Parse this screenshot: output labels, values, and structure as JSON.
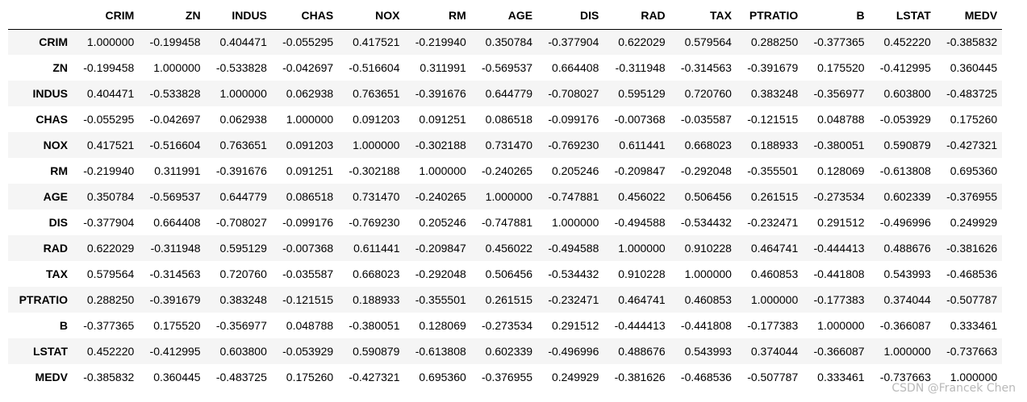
{
  "table": {
    "columns": [
      "CRIM",
      "ZN",
      "INDUS",
      "CHAS",
      "NOX",
      "RM",
      "AGE",
      "DIS",
      "RAD",
      "TAX",
      "PTRATIO",
      "B",
      "LSTAT",
      "MEDV"
    ],
    "rows": [
      {
        "label": "CRIM",
        "values": [
          "1.000000",
          "-0.199458",
          "0.404471",
          "-0.055295",
          "0.417521",
          "-0.219940",
          "0.350784",
          "-0.377904",
          "0.622029",
          "0.579564",
          "0.288250",
          "-0.377365",
          "0.452220",
          "-0.385832"
        ]
      },
      {
        "label": "ZN",
        "values": [
          "-0.199458",
          "1.000000",
          "-0.533828",
          "-0.042697",
          "-0.516604",
          "0.311991",
          "-0.569537",
          "0.664408",
          "-0.311948",
          "-0.314563",
          "-0.391679",
          "0.175520",
          "-0.412995",
          "0.360445"
        ]
      },
      {
        "label": "INDUS",
        "values": [
          "0.404471",
          "-0.533828",
          "1.000000",
          "0.062938",
          "0.763651",
          "-0.391676",
          "0.644779",
          "-0.708027",
          "0.595129",
          "0.720760",
          "0.383248",
          "-0.356977",
          "0.603800",
          "-0.483725"
        ]
      },
      {
        "label": "CHAS",
        "values": [
          "-0.055295",
          "-0.042697",
          "0.062938",
          "1.000000",
          "0.091203",
          "0.091251",
          "0.086518",
          "-0.099176",
          "-0.007368",
          "-0.035587",
          "-0.121515",
          "0.048788",
          "-0.053929",
          "0.175260"
        ]
      },
      {
        "label": "NOX",
        "values": [
          "0.417521",
          "-0.516604",
          "0.763651",
          "0.091203",
          "1.000000",
          "-0.302188",
          "0.731470",
          "-0.769230",
          "0.611441",
          "0.668023",
          "0.188933",
          "-0.380051",
          "0.590879",
          "-0.427321"
        ]
      },
      {
        "label": "RM",
        "values": [
          "-0.219940",
          "0.311991",
          "-0.391676",
          "0.091251",
          "-0.302188",
          "1.000000",
          "-0.240265",
          "0.205246",
          "-0.209847",
          "-0.292048",
          "-0.355501",
          "0.128069",
          "-0.613808",
          "0.695360"
        ]
      },
      {
        "label": "AGE",
        "values": [
          "0.350784",
          "-0.569537",
          "0.644779",
          "0.086518",
          "0.731470",
          "-0.240265",
          "1.000000",
          "-0.747881",
          "0.456022",
          "0.506456",
          "0.261515",
          "-0.273534",
          "0.602339",
          "-0.376955"
        ]
      },
      {
        "label": "DIS",
        "values": [
          "-0.377904",
          "0.664408",
          "-0.708027",
          "-0.099176",
          "-0.769230",
          "0.205246",
          "-0.747881",
          "1.000000",
          "-0.494588",
          "-0.534432",
          "-0.232471",
          "0.291512",
          "-0.496996",
          "0.249929"
        ]
      },
      {
        "label": "RAD",
        "values": [
          "0.622029",
          "-0.311948",
          "0.595129",
          "-0.007368",
          "0.611441",
          "-0.209847",
          "0.456022",
          "-0.494588",
          "1.000000",
          "0.910228",
          "0.464741",
          "-0.444413",
          "0.488676",
          "-0.381626"
        ]
      },
      {
        "label": "TAX",
        "values": [
          "0.579564",
          "-0.314563",
          "0.720760",
          "-0.035587",
          "0.668023",
          "-0.292048",
          "0.506456",
          "-0.534432",
          "0.910228",
          "1.000000",
          "0.460853",
          "-0.441808",
          "0.543993",
          "-0.468536"
        ]
      },
      {
        "label": "PTRATIO",
        "values": [
          "0.288250",
          "-0.391679",
          "0.383248",
          "-0.121515",
          "0.188933",
          "-0.355501",
          "0.261515",
          "-0.232471",
          "0.464741",
          "0.460853",
          "1.000000",
          "-0.177383",
          "0.374044",
          "-0.507787"
        ]
      },
      {
        "label": "B",
        "values": [
          "-0.377365",
          "0.175520",
          "-0.356977",
          "0.048788",
          "-0.380051",
          "0.128069",
          "-0.273534",
          "0.291512",
          "-0.444413",
          "-0.441808",
          "-0.177383",
          "1.000000",
          "-0.366087",
          "0.333461"
        ]
      },
      {
        "label": "LSTAT",
        "values": [
          "0.452220",
          "-0.412995",
          "0.603800",
          "-0.053929",
          "0.590879",
          "-0.613808",
          "0.602339",
          "-0.496996",
          "0.488676",
          "0.543993",
          "0.374044",
          "-0.366087",
          "1.000000",
          "-0.737663"
        ]
      },
      {
        "label": "MEDV",
        "values": [
          "-0.385832",
          "0.360445",
          "-0.483725",
          "0.175260",
          "-0.427321",
          "0.695360",
          "-0.376955",
          "0.249929",
          "-0.381626",
          "-0.468536",
          "-0.507787",
          "0.333461",
          "-0.737663",
          "1.000000"
        ]
      }
    ]
  },
  "watermark": "CSDN @Francek Chen",
  "colors": {
    "stripe": "#f5f5f5",
    "watermark": "#b9b9b9"
  }
}
